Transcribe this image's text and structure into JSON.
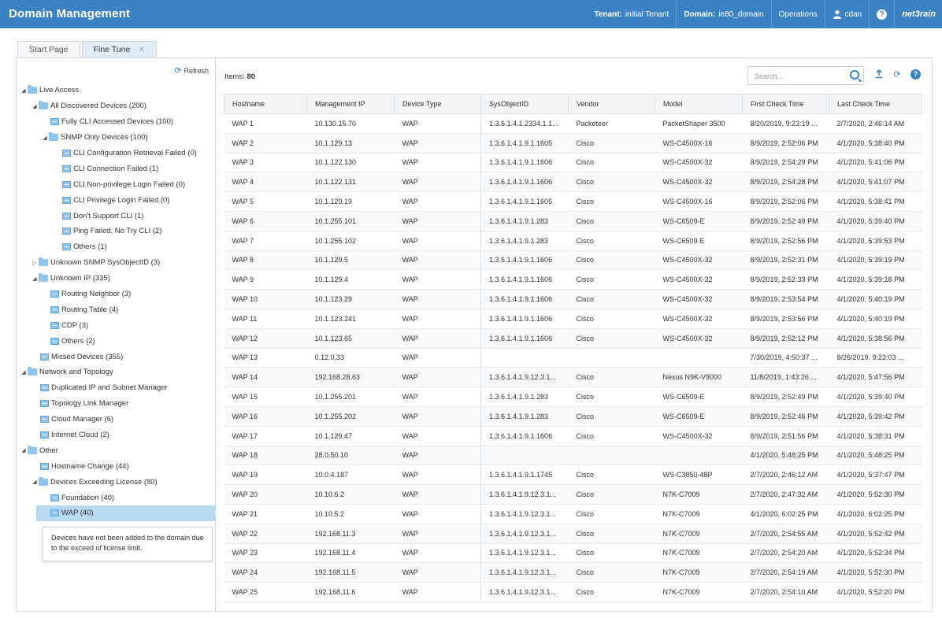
{
  "header": {
    "title": "Domain Management",
    "tenant_label": "Tenant:",
    "tenant_value": "initial Tenant",
    "domain_label": "Domain:",
    "domain_value": "ie80_domain",
    "operations": "Operations",
    "user": "cdan",
    "help": "?",
    "logo": "net3rain",
    "bar_color": "#3a82c4"
  },
  "tabs": [
    {
      "label": "Start Page"
    },
    {
      "label": "Fine Tune"
    }
  ],
  "tree": {
    "refresh_label": "Refresh",
    "nodes": [
      {
        "label": "Live Access"
      },
      {
        "label": "All Discovered Devices (200)"
      },
      {
        "label": "Fully CLI Accessed Devices (100)"
      },
      {
        "label": "SNMP Only Devices (100)"
      },
      {
        "label": "CLI Configuration Retrieval Failed (0)"
      },
      {
        "label": "CLI Connection Failed (1)"
      },
      {
        "label": "CLI Non-privilege Login Failed (0)"
      },
      {
        "label": "CLI Privilege Login Failed (0)"
      },
      {
        "label": "Don't Support CLI (1)"
      },
      {
        "label": "Ping Failed, No Try CLI (2)"
      },
      {
        "label": "Others (1)"
      },
      {
        "label": "Unknown SNMP SysObjectID (3)"
      },
      {
        "label": "Unknown IP (335)"
      },
      {
        "label": "Routing Neighbor (3)"
      },
      {
        "label": "Routing Table (4)"
      },
      {
        "label": "CDP (3)"
      },
      {
        "label": "Others (2)"
      },
      {
        "label": "Missed Devices (355)"
      },
      {
        "label": "Network and Topology"
      },
      {
        "label": "Duplicated IP and Subnet Manager"
      },
      {
        "label": "Topology Link Manager"
      },
      {
        "label": "Cloud Manager (6)"
      },
      {
        "label": "Internet Cloud (2)"
      },
      {
        "label": "Other"
      },
      {
        "label": "Hostname Change (44)"
      },
      {
        "label": "Devices Exceeding License (80)"
      },
      {
        "label": "Foundation (40)"
      },
      {
        "label": "WAP (40)"
      }
    ],
    "tooltip": "Devices have not been added to the domain due to the exceed of license limit."
  },
  "toolbar": {
    "items_label": "Items:",
    "items_count": "80",
    "search_placeholder": "Search..."
  },
  "table": {
    "columns": [
      "Hostname",
      "Management IP",
      "Device Type",
      "SysObjectID",
      "Vendor",
      "Model",
      "First Check Time",
      "Last Check Time"
    ],
    "rows": [
      [
        "WAP 1",
        "10.130.15.70",
        "WAP",
        "1.3.6.1.4.1.2334.1.1...",
        "Packeteer",
        "PacketShaper 3500",
        "8/20/2019, 9:23:19 ...",
        "2/7/2020, 2:46:14 AM"
      ],
      [
        "WAP 2",
        "10.1.129.13",
        "WAP",
        "1.3.6.1.4.1.9.1.1605",
        "Cisco",
        "WS-C4500X-16",
        "8/9/2019, 2:52:06 PM",
        "4/1/2020, 5:38:40 PM"
      ],
      [
        "WAP 3",
        "10.1.122.130",
        "WAP",
        "1.3.6.1.4.1.9.1.1606",
        "Cisco",
        "WS-C4500X-32",
        "8/9/2019, 2:54:29 PM",
        "4/1/2020, 5:41:06 PM"
      ],
      [
        "WAP 4",
        "10.1.122.131",
        "WAP",
        "1.3.6.1.4.1.9.1.1606",
        "Cisco",
        "WS-C4500X-32",
        "8/9/2019, 2:54:28 PM",
        "4/1/2020, 5:41:07 PM"
      ],
      [
        "WAP 5",
        "10.1.129.19",
        "WAP",
        "1.3.6.1.4.1.9.1.1605",
        "Cisco",
        "WS-C4500X-16",
        "8/9/2019, 2:52:06 PM",
        "4/1/2020, 5:38:41 PM"
      ],
      [
        "WAP 6",
        "10.1.255.101",
        "WAP",
        "1.3.6.1.4.1.9.1.283",
        "Cisco",
        "WS-C6509-E",
        "8/9/2019, 2:52:49 PM",
        "4/1/2020, 5:39:40 PM"
      ],
      [
        "WAP 7",
        "10.1.255.102",
        "WAP",
        "1.3.6.1.4.1.9.1.283",
        "Cisco",
        "WS-C6509-E",
        "8/9/2019, 2:52:56 PM",
        "4/1/2020, 5:39:53 PM"
      ],
      [
        "WAP 8",
        "10.1.129.5",
        "WAP",
        "1.3.6.1.4.1.9.1.1606",
        "Cisco",
        "WS-C4500X-32",
        "8/9/2019, 2:52:31 PM",
        "4/1/2020, 5:39:19 PM"
      ],
      [
        "WAP 9",
        "10.1.129.4",
        "WAP",
        "1.3.6.1.4.1.9.1.1606",
        "Cisco",
        "WS-C4500X-32",
        "8/9/2019, 2:52:33 PM",
        "4/1/2020, 5:39:18 PM"
      ],
      [
        "WAP 10",
        "10.1.123.29",
        "WAP",
        "1.3.6.1.4.1.9.1.1606",
        "Cisco",
        "WS-C4500X-32",
        "8/9/2019, 2:53:54 PM",
        "4/1/2020, 5:40:19 PM"
      ],
      [
        "WAP 11",
        "10.1.123.241",
        "WAP",
        "1.3.6.1.4.1.9.1.1606",
        "Cisco",
        "WS-C4500X-32",
        "8/9/2019, 2:53:56 PM",
        "4/1/2020, 5:40:19 PM"
      ],
      [
        "WAP 12",
        "10.1.123.65",
        "WAP",
        "1.3.6.1.4.1.9.1.1606",
        "Cisco",
        "WS-C4500X-32",
        "8/9/2019, 2:52:12 PM",
        "4/1/2020, 5:38:56 PM"
      ],
      [
        "WAP 13",
        "0.12.0.33",
        "WAP",
        "",
        "",
        "",
        "7/30/2019, 4:50:37 ...",
        "8/26/2019, 9:23:03 ..."
      ],
      [
        "WAP 14",
        "192.168.28.63",
        "WAP",
        "1.3.6.1.4.1.9.12.3.1...",
        "Cisco",
        "Nexus N9K-V9000",
        "11/8/2019, 1:43:26 ...",
        "4/1/2020, 5:47:56 PM"
      ],
      [
        "WAP 15",
        "10.1.255.201",
        "WAP",
        "1.3.6.1.4.1.9.1.283",
        "Cisco",
        "WS-C6509-E",
        "8/9/2019, 2:52:49 PM",
        "4/1/2020, 5:39:40 PM"
      ],
      [
        "WAP 16",
        "10.1.255.202",
        "WAP",
        "1.3.6.1.4.1.9.1.283",
        "Cisco",
        "WS-C6509-E",
        "8/9/2019, 2:52:46 PM",
        "4/1/2020, 5:39:42 PM"
      ],
      [
        "WAP 17",
        "10.1.129.47",
        "WAP",
        "1.3.6.1.4.1.9.1.1606",
        "Cisco",
        "WS-C4500X-32",
        "8/9/2019, 2:51:56 PM",
        "4/1/2020, 5:38:31 PM"
      ],
      [
        "WAP 18",
        "28.0.50.10",
        "WAP",
        "",
        "",
        "",
        "4/1/2020, 5:48:25 PM",
        "4/1/2020, 5:48:25 PM"
      ],
      [
        "WAP 19",
        "10.0.4.187",
        "WAP",
        "1.3.6.1.4.1.9.1.1745",
        "Cisco",
        "WS-C3850-48P",
        "2/7/2020, 2:46:12 AM",
        "4/1/2020, 5:37:47 PM"
      ],
      [
        "WAP 20",
        "10.10.6.2",
        "WAP",
        "1.3.6.1.4.1.9.12.3.1...",
        "Cisco",
        "N7K-C7009",
        "2/7/2020, 2:47:32 AM",
        "4/1/2020, 5:52:30 PM"
      ],
      [
        "WAP 21",
        "10.10.5.2",
        "WAP",
        "1.3.6.1.4.1.9.12.3.1...",
        "Cisco",
        "N7K-C7009",
        "4/1/2020, 6:02:25 PM",
        "4/1/2020, 6:02:25 PM"
      ],
      [
        "WAP 22",
        "192.168.11.3",
        "WAP",
        "1.3.6.1.4.1.9.12.3.1...",
        "Cisco",
        "N7K-C7009",
        "2/7/2020, 2:54:55 AM",
        "4/1/2020, 5:52:42 PM"
      ],
      [
        "WAP 23",
        "192.168.11.4",
        "WAP",
        "1.3.6.1.4.1.9.12.3.1...",
        "Cisco",
        "N7K-C7009",
        "2/7/2020, 2:54:20 AM",
        "4/1/2020, 5:52:34 PM"
      ],
      [
        "WAP 24",
        "192.168.11.5",
        "WAP",
        "1.3.6.1.4.1.9.12.3.1...",
        "Cisco",
        "N7K-C7009",
        "2/7/2020, 2:54:19 AM",
        "4/1/2020, 5:52:30 PM"
      ],
      [
        "WAP 25",
        "192.168.11.6",
        "WAP",
        "1.3.6.1.4.1.9.12.3.1...",
        "Cisco",
        "N7K-C7009",
        "2/7/2020, 2:54:10 AM",
        "4/1/2020, 5:52:20 PM"
      ]
    ]
  }
}
